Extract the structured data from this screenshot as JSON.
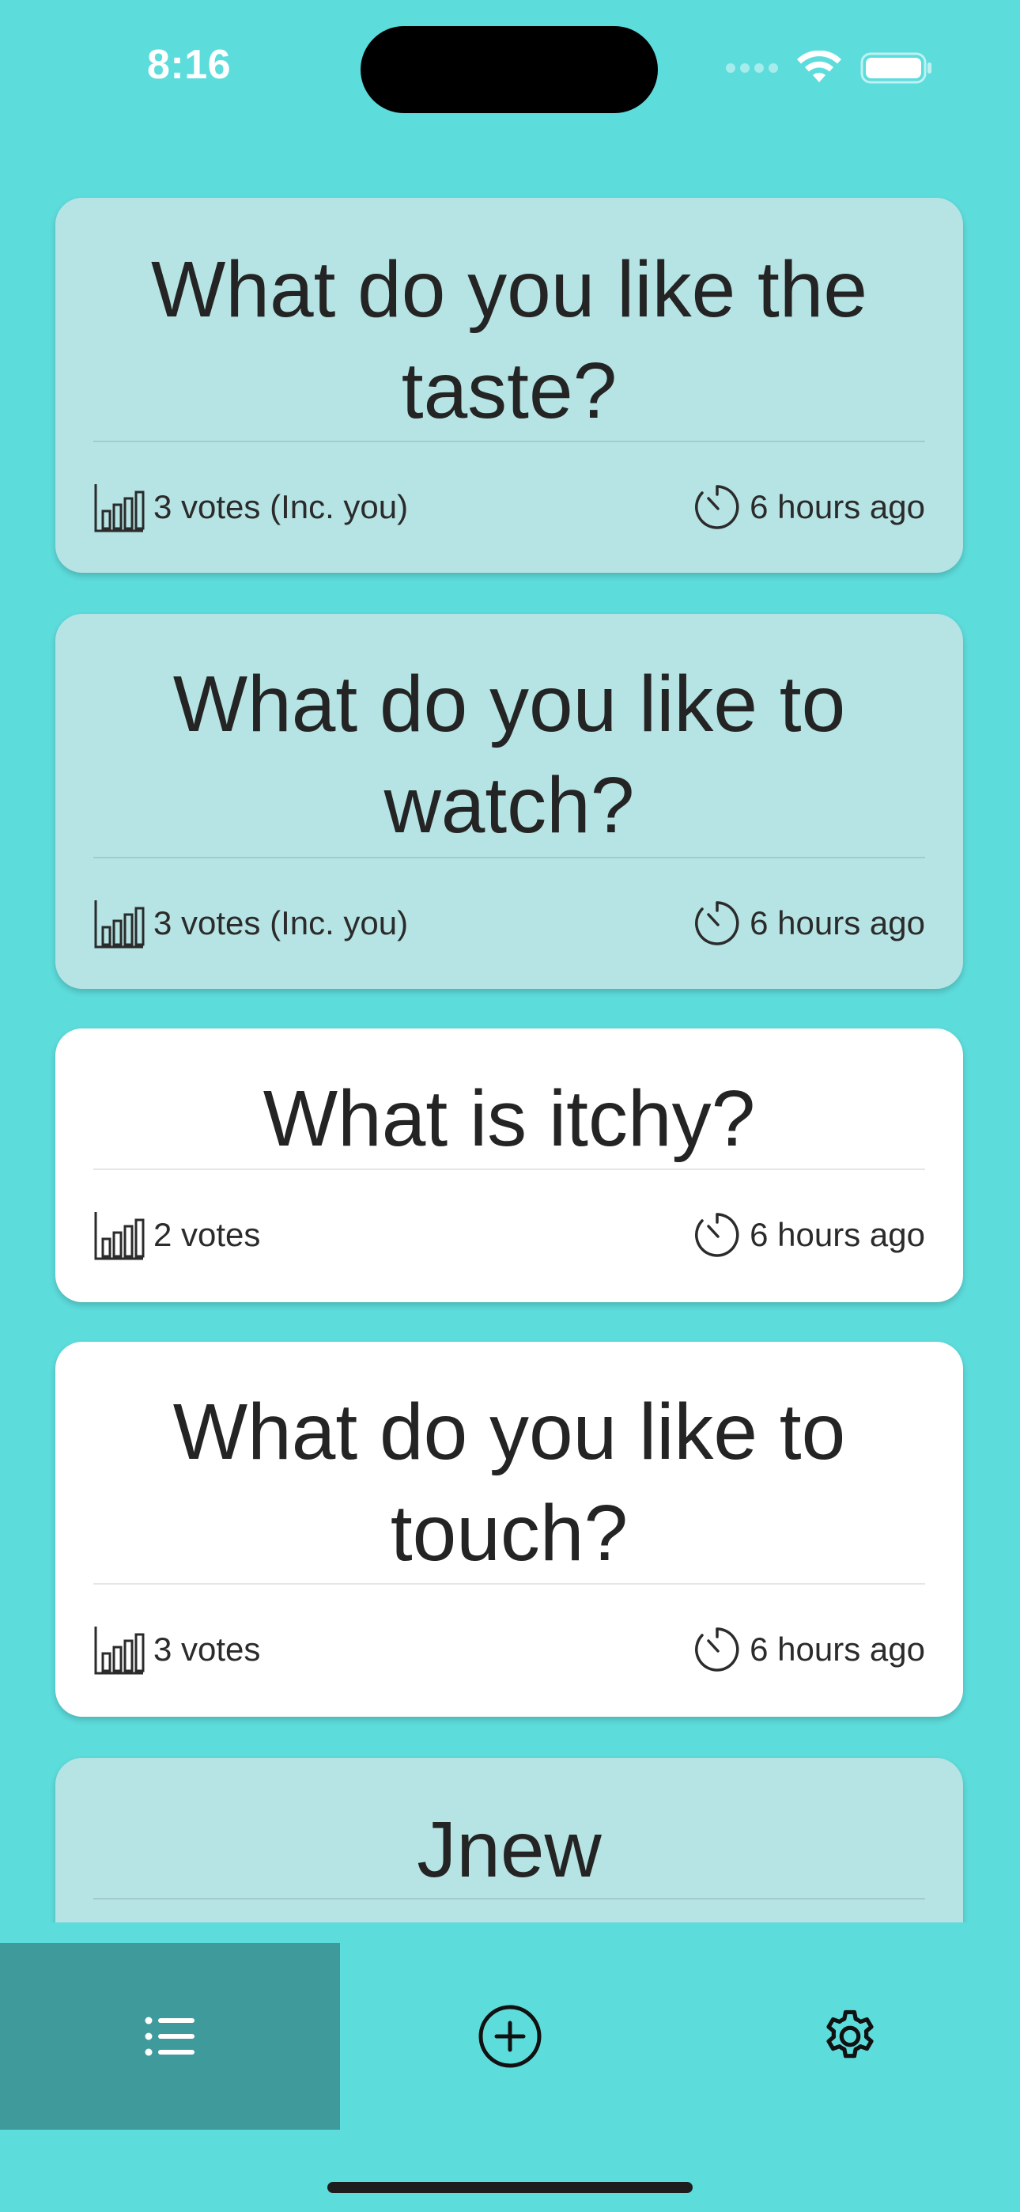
{
  "status_bar": {
    "time": "8:16"
  },
  "polls": [
    {
      "title": "What do you like the taste?",
      "votes": "3 votes (Inc. you)",
      "time": "6 hours ago",
      "voted": true
    },
    {
      "title": "What do you like to watch?",
      "votes": "3 votes (Inc. you)",
      "time": "6 hours ago",
      "voted": true
    },
    {
      "title": "What is itchy?",
      "votes": "2 votes",
      "time": "6 hours ago",
      "voted": false
    },
    {
      "title": "What do you like to touch?",
      "votes": "3 votes",
      "time": "6 hours ago",
      "voted": false
    },
    {
      "title": "Jnew",
      "voted": true
    }
  ],
  "tabbar": {
    "tabs": [
      {
        "icon": "list-icon",
        "active": true
      },
      {
        "icon": "plus-circle-icon",
        "active": false
      },
      {
        "icon": "gear-icon",
        "active": false
      }
    ]
  },
  "colors": {
    "background": "#5ddcdc",
    "voted_card": "#b6e3e3",
    "open_card": "#ffffff",
    "active_tab": "#3f9a9b",
    "text": "#242424"
  }
}
